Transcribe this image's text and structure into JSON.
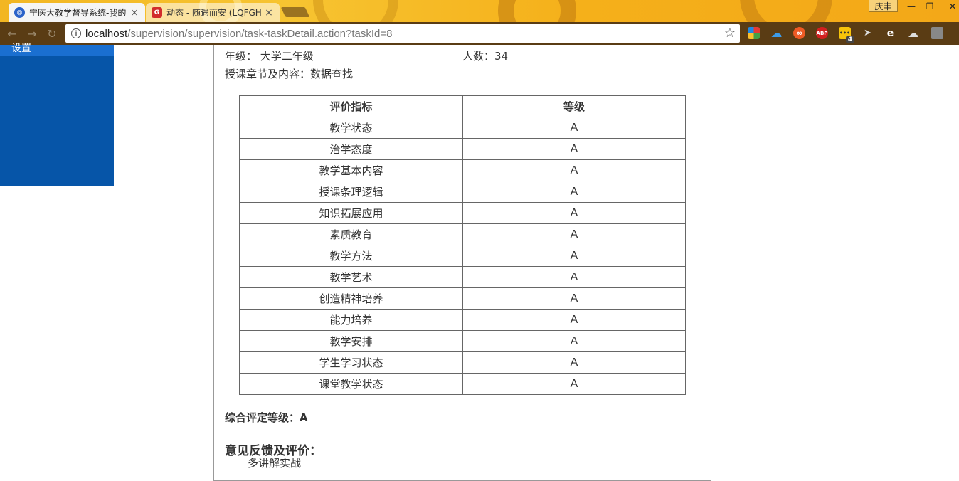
{
  "browser": {
    "tabs": [
      {
        "title": "宁医大教学督导系统-我的",
        "active": true
      },
      {
        "title": "动态 - 随遇而安 (LQFGH",
        "active": false
      }
    ],
    "user_name": "庆丰",
    "window_controls": {
      "minimize": "—",
      "restore": "❐",
      "close": "✕"
    },
    "url_host": "localhost",
    "url_path": "/supervision/supervision/task-taskDetail.action?taskId=8",
    "extension_badge": "4",
    "extensions": [
      "chrome-store-icon",
      "onedrive-icon",
      "infinity-icon",
      "adblock-plus-icon",
      "notes-icon",
      "cursor-icon",
      "edge-icon",
      "cloud-icon",
      "ext-grey-icon"
    ],
    "theme_colors": {
      "frame": "#f3b11f",
      "toolbar": "#5a3c14"
    }
  },
  "sidebar": {
    "active_item": "设置",
    "color": "#0655a8"
  },
  "course_info": {
    "grade_label": "年级：",
    "grade_value": "大学二年级",
    "count_label": "人数：",
    "count_value": "34",
    "chapter_label": "授课章节及内容：",
    "chapter_value": "数据查找"
  },
  "evaluation": {
    "headers": [
      "评价指标",
      "等级"
    ],
    "rows": [
      {
        "indicator": "教学状态",
        "grade": "A"
      },
      {
        "indicator": "治学态度",
        "grade": "A"
      },
      {
        "indicator": "教学基本内容",
        "grade": "A"
      },
      {
        "indicator": "授课条理逻辑",
        "grade": "A"
      },
      {
        "indicator": "知识拓展应用",
        "grade": "A"
      },
      {
        "indicator": "素质教育",
        "grade": "A"
      },
      {
        "indicator": "教学方法",
        "grade": "A"
      },
      {
        "indicator": "教学艺术",
        "grade": "A"
      },
      {
        "indicator": "创造精神培养",
        "grade": "A"
      },
      {
        "indicator": "能力培养",
        "grade": "A"
      },
      {
        "indicator": "教学安排",
        "grade": "A"
      },
      {
        "indicator": "学生学习状态",
        "grade": "A"
      },
      {
        "indicator": "课堂教学状态",
        "grade": "A"
      }
    ]
  },
  "overall": {
    "label": "综合评定等级：",
    "value": "A"
  },
  "feedback": {
    "title": "意见反馈及评价：",
    "text": "多讲解实战"
  }
}
